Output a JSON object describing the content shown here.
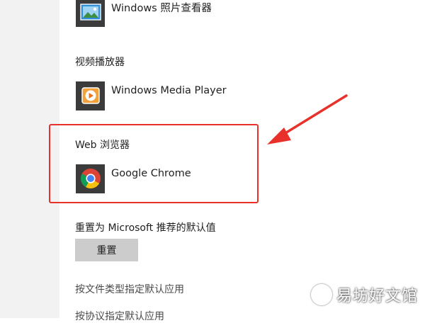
{
  "photo_viewer": {
    "app_name": "Windows 照片查看器"
  },
  "video_player": {
    "section_label": "视频播放器",
    "app_name": "Windows Media Player"
  },
  "web_browser": {
    "section_label": "Web 浏览器",
    "app_name": "Google Chrome"
  },
  "reset": {
    "label": "重置为 Microsoft 推荐的默认值",
    "button_label": "重置"
  },
  "links": [
    "按文件类型指定默认应用",
    "按协议指定默认应用"
  ],
  "watermark": {
    "text": "易坊好文馆"
  },
  "colors": {
    "highlight": "#e8312a",
    "icon_tile": "#3b3b3b",
    "button_bg": "#cccccc"
  }
}
